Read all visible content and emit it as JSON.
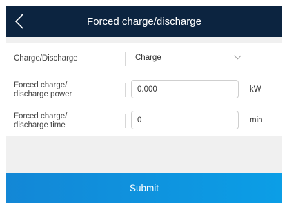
{
  "header": {
    "title": "Forced charge/discharge",
    "back_icon": "chevron-left-icon"
  },
  "form": {
    "mode": {
      "label": "Charge/Discharge",
      "value": "Charge",
      "icon": "chevron-down-icon"
    },
    "power": {
      "label_line1": "Forced charge/",
      "label_line2": "discharge power",
      "value": "0.000",
      "unit": "kW"
    },
    "time": {
      "label_line1": "Forced charge/",
      "label_line2": "discharge time",
      "value": "0",
      "unit": "min"
    }
  },
  "footer": {
    "submit_label": "Submit"
  },
  "colors": {
    "header_bg": "#0c2440",
    "submit_gradient_start": "#1387d6",
    "submit_gradient_end": "#0b9ee6",
    "page_bg": "#f0f0f0"
  }
}
